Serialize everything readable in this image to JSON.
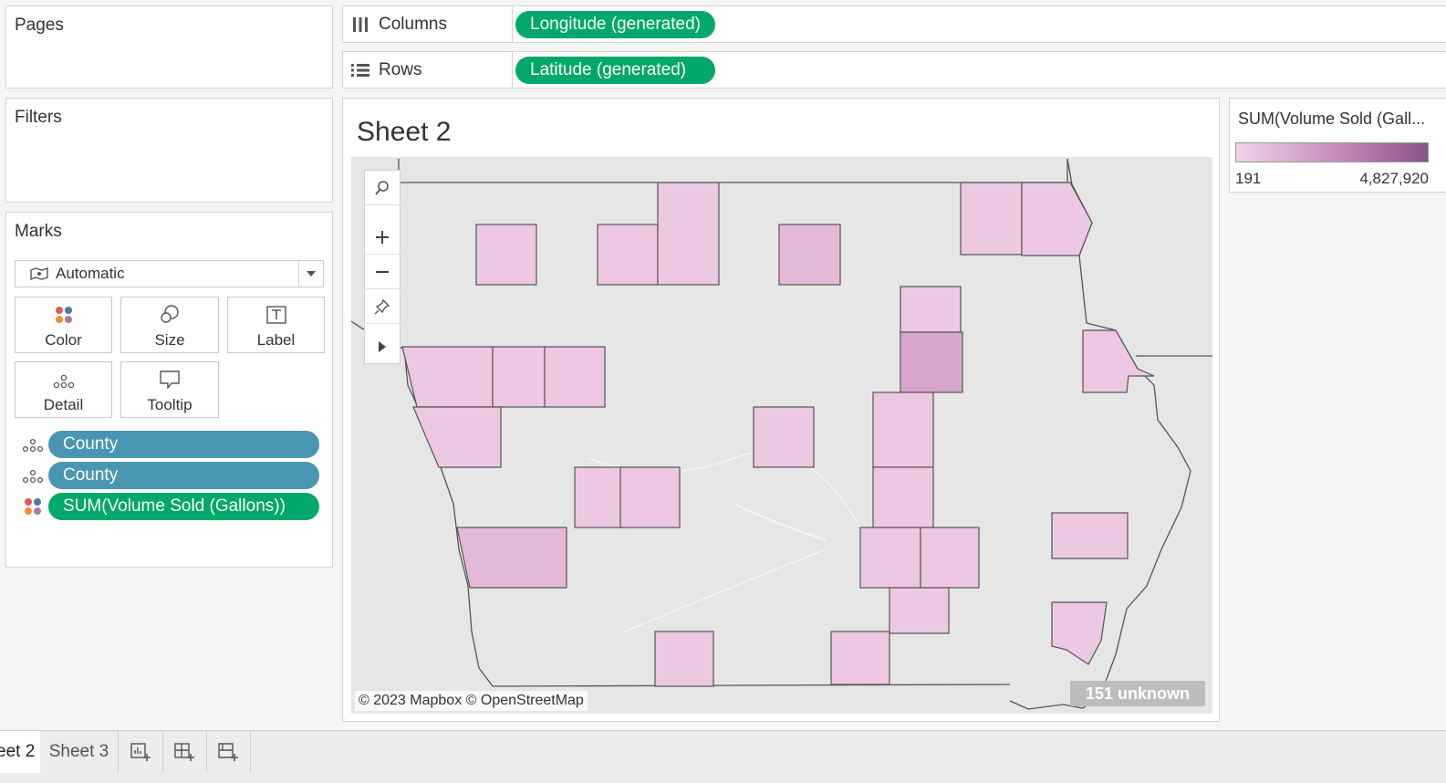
{
  "pages_panel": {
    "title": "Pages"
  },
  "filters_panel": {
    "title": "Filters"
  },
  "shelves": {
    "columns": {
      "label": "Columns",
      "pill": "Longitude (generated)"
    },
    "rows": {
      "label": "Rows",
      "pill": "Latitude (generated)"
    }
  },
  "marks": {
    "title": "Marks",
    "mark_type": "Automatic",
    "buttons": {
      "color": "Color",
      "size": "Size",
      "label": "Label",
      "detail": "Detail",
      "tooltip": "Tooltip"
    },
    "fields": [
      {
        "icon": "detail-icon",
        "label": "County",
        "color": "#4996b2"
      },
      {
        "icon": "detail-icon",
        "label": "County",
        "color": "#4996b2"
      },
      {
        "icon": "color-icon",
        "label": "SUM(Volume Sold (Gallons))",
        "color": "#00a86b"
      }
    ]
  },
  "sheet": {
    "title": "Sheet 2"
  },
  "map": {
    "attribution": "© 2023 Mapbox © OpenStreetMap",
    "unknown_badge": "151 unknown",
    "fill_colors": {
      "light": "#edc8e2",
      "mid": "#e3b9d7",
      "dark": "#d8a6cb"
    }
  },
  "legend": {
    "title": "SUM(Volume Sold (Gall...",
    "min_label": "191",
    "max_label": "4,827,920",
    "min_color": "#f1d3ea",
    "max_color": "#8a5286"
  },
  "tabs": {
    "active": "eet 2",
    "inactive": "Sheet 3"
  },
  "colors": {
    "pill_green": "#00a86b",
    "pill_blue": "#4996b2"
  }
}
